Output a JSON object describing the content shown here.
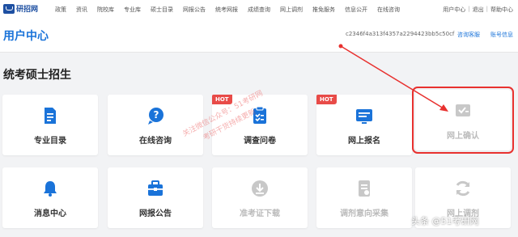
{
  "site": {
    "name": "研招网"
  },
  "nav": [
    "政策",
    "资讯",
    "院校库",
    "专业库",
    "硕士目录",
    "网报公告",
    "统考网报",
    "成绩查询",
    "网上调剂",
    "推免服务",
    "信息公开",
    "在线咨询"
  ],
  "top_right": {
    "user_center": "用户中心",
    "logout": "退出",
    "help": "帮助中心"
  },
  "header": {
    "title": "用户中心",
    "account_id": "c2346f4a313f4357a2294423bb5c50cf",
    "consult": "咨询客服",
    "account_info": "账号信息"
  },
  "section": {
    "title": "统考硕士招生"
  },
  "hot_label": "HOT",
  "tiles_row1": [
    {
      "label": "专业目录",
      "icon": "doc-list-icon",
      "color": "#1a73d9",
      "hot": false,
      "disabled": false
    },
    {
      "label": "在线咨询",
      "icon": "chat-question-icon",
      "color": "#1a73d9",
      "hot": false,
      "disabled": false
    },
    {
      "label": "调查问卷",
      "icon": "survey-icon",
      "color": "#1a73d9",
      "hot": true,
      "disabled": false
    },
    {
      "label": "网上报名",
      "icon": "register-card-icon",
      "color": "#1a73d9",
      "hot": true,
      "disabled": false
    },
    {
      "label": "网上确认",
      "icon": "confirm-check-icon",
      "color": "#c8c8c8",
      "hot": false,
      "disabled": true
    }
  ],
  "tiles_row2": [
    {
      "label": "消息中心",
      "icon": "bell-icon",
      "color": "#1a73d9",
      "disabled": false
    },
    {
      "label": "网报公告",
      "icon": "briefcase-icon",
      "color": "#1a73d9",
      "disabled": false
    },
    {
      "label": "准考证下载",
      "icon": "download-icon",
      "color": "#c8c8c8",
      "disabled": true
    },
    {
      "label": "调剂意向采集",
      "icon": "form-icon",
      "color": "#c8c8c8",
      "disabled": true
    },
    {
      "label": "网上调剂",
      "icon": "refresh-icon",
      "color": "#c8c8c8",
      "disabled": true
    }
  ],
  "watermark": {
    "line1": "关注微信公众号：51考研网",
    "line2": "考研干货持续更新"
  },
  "source_tag": "头条 @51考研网"
}
